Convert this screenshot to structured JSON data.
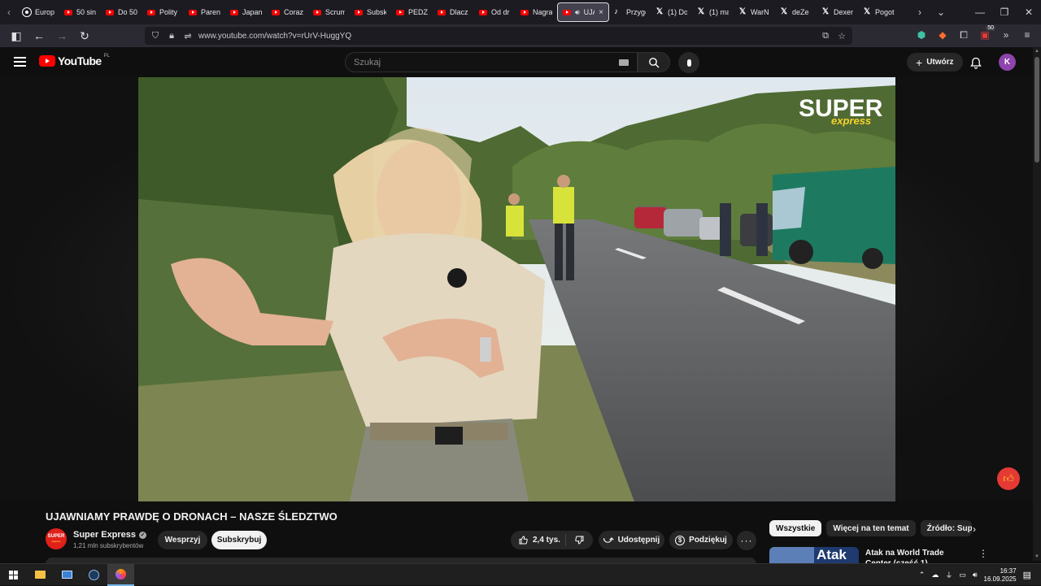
{
  "browser": {
    "tabs": [
      {
        "label": "Europ",
        "icon": "circle-icon"
      },
      {
        "label": "50 sin",
        "icon": "youtube-icon"
      },
      {
        "label": "Do 50",
        "icon": "youtube-icon"
      },
      {
        "label": "Polity",
        "icon": "youtube-icon"
      },
      {
        "label": "Parent",
        "icon": "youtube-icon"
      },
      {
        "label": "Japan",
        "icon": "youtube-icon"
      },
      {
        "label": "Coraz",
        "icon": "youtube-icon"
      },
      {
        "label": "Scrum",
        "icon": "youtube-icon"
      },
      {
        "label": "Subsk",
        "icon": "youtube-icon"
      },
      {
        "label": "PEDZI",
        "icon": "youtube-icon"
      },
      {
        "label": "Dlacz",
        "icon": "youtube-icon"
      },
      {
        "label": "Od dr",
        "icon": "youtube-icon"
      },
      {
        "label": "Nagra",
        "icon": "youtube-icon"
      }
    ],
    "active_tab": {
      "label": "UJA",
      "close": "×"
    },
    "tabs_after": [
      {
        "label": "Przygo",
        "icon": "tiktok-icon"
      },
      {
        "label": "(1) Do",
        "icon": "x-icon"
      },
      {
        "label": "(1) ma",
        "icon": "x-icon"
      },
      {
        "label": "WarN",
        "icon": "x-icon"
      },
      {
        "label": "deZe",
        "icon": "x-icon"
      },
      {
        "label": "Dexer",
        "icon": "x-icon"
      },
      {
        "label": "Pogot",
        "icon": "x-icon"
      }
    ],
    "url": "www.youtube.com/watch?v=rUrV-HuggYQ",
    "extension_badge": "50"
  },
  "youtube": {
    "logo_text": "YouTube",
    "country_code": "PL",
    "search_placeholder": "Szukaj",
    "create_label": "Utwórz",
    "avatar_letter": "K",
    "video": {
      "watermark_main": "SUPER",
      "watermark_sub": "express"
    },
    "title": "UJAWNIAMY PRAWDĘ O DRONACH – NASZE ŚLEDZTWO",
    "channel": {
      "name": "Super Express",
      "subscribers": "1,21 mln subskrybentów",
      "avatar_top": "SUPER",
      "avatar_bottom": "express"
    },
    "buttons": {
      "support": "Wesprzyj",
      "subscribe": "Subskrybuj",
      "likes": "2,4 tys.",
      "share": "Udostępnij",
      "thanks": "Podziękuj"
    },
    "chips": [
      "Wszystkie",
      "Więcej na ten temat",
      "Źródło: Super"
    ],
    "recommendation": {
      "thumb_text": "Atak",
      "title": "Atak na World Trade Center (część 1)"
    }
  },
  "taskbar": {
    "time": "16:37",
    "date": "16.09.2025"
  }
}
